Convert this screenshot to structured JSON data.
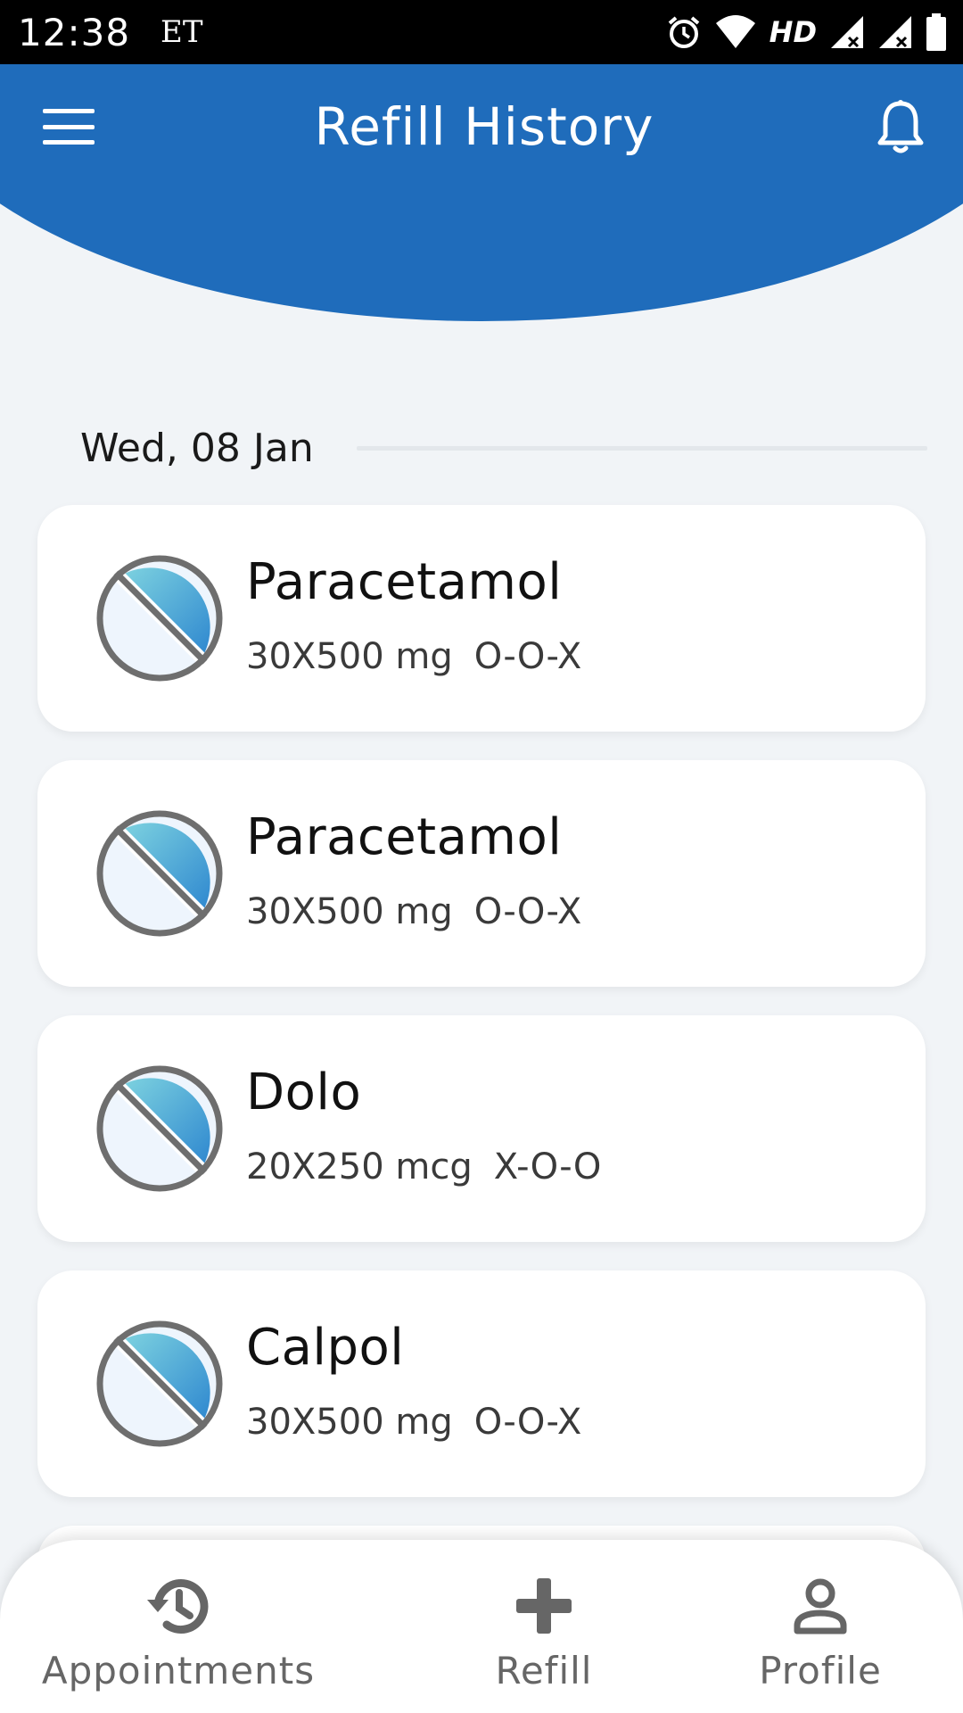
{
  "status_bar": {
    "time": "12:38",
    "carrier": "ET",
    "network": "HD",
    "icons": [
      "alarm-icon",
      "wifi-icon",
      "signal-icon",
      "signal-icon",
      "battery-icon"
    ]
  },
  "header": {
    "title": "Refill History",
    "menu_icon": "hamburger-menu-icon",
    "notification_icon": "bell-icon",
    "color": "#1f6cbb"
  },
  "history": {
    "date": "Wed, 08 Jan",
    "items": [
      {
        "name": "Paracetamol",
        "quantity": "30X500 mg",
        "dosage": "O-O-X",
        "icon": "pill-icon"
      },
      {
        "name": "Paracetamol",
        "quantity": "30X500 mg",
        "dosage": "O-O-X",
        "icon": "pill-icon"
      },
      {
        "name": "Dolo",
        "quantity": "20X250 mcg",
        "dosage": "X-O-O",
        "icon": "pill-icon"
      },
      {
        "name": "Calpol",
        "quantity": "30X500 mg",
        "dosage": "O-O-X",
        "icon": "pill-icon"
      }
    ]
  },
  "bottom_nav": {
    "items": [
      {
        "label": "Appointments",
        "icon": "history-icon"
      },
      {
        "label": "Refill",
        "icon": "plus-icon"
      },
      {
        "label": "Profile",
        "icon": "person-icon"
      }
    ],
    "icon_color": "#666666"
  }
}
